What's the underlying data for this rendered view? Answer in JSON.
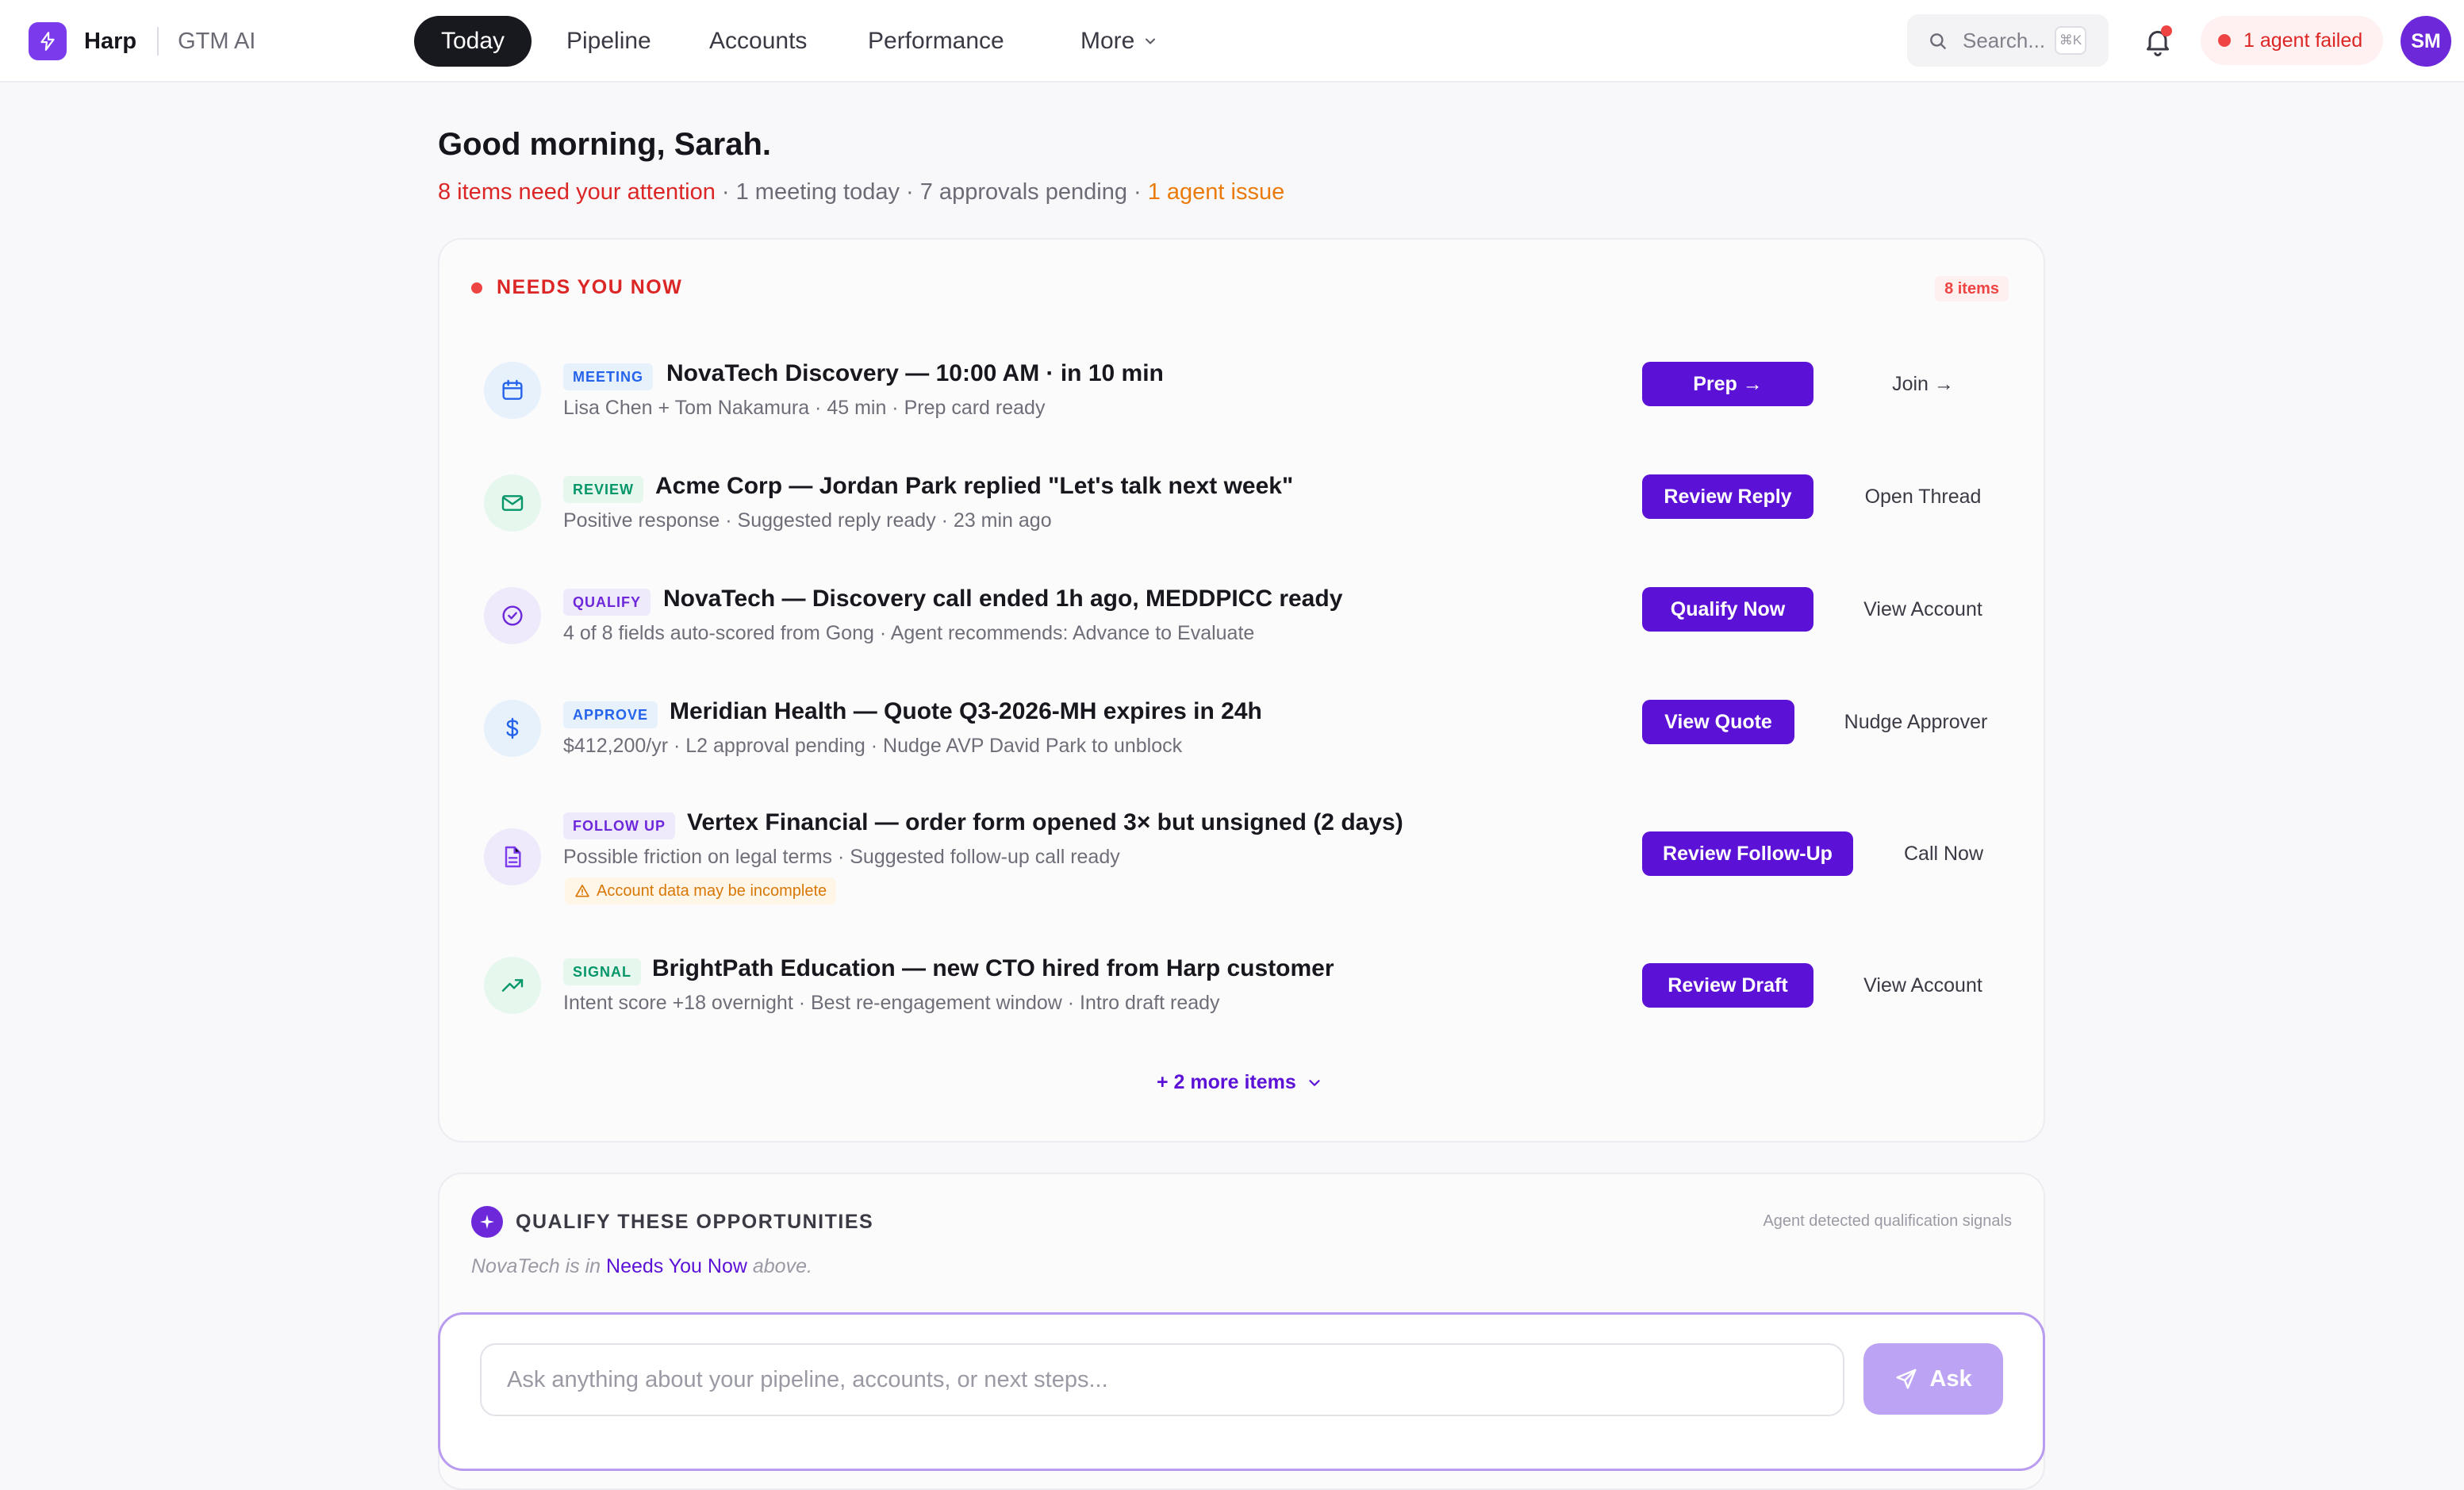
{
  "app": {
    "name": "Harp",
    "subtitle": "GTM AI"
  },
  "nav": {
    "items": [
      "Today",
      "Pipeline",
      "Accounts",
      "Performance"
    ],
    "active": "Today",
    "more_label": "More"
  },
  "search": {
    "placeholder": "Search...",
    "shortcut": "⌘K"
  },
  "alerts": {
    "agent_failed": "1 agent failed",
    "has_notification": true
  },
  "user": {
    "initials": "SM"
  },
  "greeting": {
    "title": "Good morning, Sarah.",
    "attention": "8 items need your attention",
    "sep": " · ",
    "meetings": "1 meeting today",
    "approvals": "7 approvals pending",
    "agent_issue": "1 agent issue"
  },
  "needs_you_now": {
    "title": "NEEDS YOU NOW",
    "count": "8 items",
    "items": [
      {
        "tag": "MEETING",
        "icon": "calendar-icon",
        "title": "NovaTech Discovery — 10:00 AM · in 10 min",
        "subtitle": "Lisa Chen + Tom Nakamura · 45 min · Prep card ready",
        "primary": "Prep →",
        "secondary": "Join →"
      },
      {
        "tag": "REVIEW",
        "icon": "mail-icon",
        "title": "Acme Corp — Jordan Park replied \"Let's talk next week\"",
        "subtitle": "Positive response · Suggested reply ready · 23 min ago",
        "primary": "Review Reply",
        "secondary": "Open Thread"
      },
      {
        "tag": "QUALIFY",
        "icon": "check-circle-icon",
        "title": "NovaTech — Discovery call ended 1h ago, MEDDPICC ready",
        "subtitle": "4 of 8 fields auto-scored from Gong · Agent recommends: Advance to Evaluate",
        "primary": "Qualify Now",
        "secondary": "View Account"
      },
      {
        "tag": "APPROVE",
        "icon": "dollar-icon",
        "title": "Meridian Health — Quote Q3-2026-MH expires in 24h",
        "subtitle": "$412,200/yr · L2 approval pending · Nudge AVP David Park to unblock",
        "primary": "View Quote",
        "secondary": "Nudge Approver"
      },
      {
        "tag": "FOLLOW UP",
        "icon": "document-icon",
        "title": "Vertex Financial — order form opened 3× but unsigned (2 days)",
        "subtitle": "Possible friction on legal terms · Suggested follow-up call ready",
        "warning": "Account data may be incomplete",
        "primary": "Review Follow-Up",
        "secondary": "Call Now"
      },
      {
        "tag": "SIGNAL",
        "icon": "trending-up-icon",
        "title": "BrightPath Education — new CTO hired from Harp customer",
        "subtitle": "Intent score +18 overnight · Best re-engagement window · Intro draft ready",
        "primary": "Review Draft",
        "secondary": "View Account"
      }
    ],
    "more_label": "+ 2 more items"
  },
  "qualify": {
    "title": "QUALIFY THESE OPPORTUNITIES",
    "note": "Agent detected qualification signals",
    "line_prefix": "NovaTech is in",
    "line_link": "Needs You Now",
    "line_suffix": "above."
  },
  "ask": {
    "placeholder": "Ask anything about your pipeline, accounts, or next steps...",
    "button": "Ask"
  },
  "colors": {
    "brand": "#7c3aed",
    "primary_button": "#5b12d6",
    "alert_red": "#dc2626",
    "warning_orange": "#ea7a0a"
  }
}
